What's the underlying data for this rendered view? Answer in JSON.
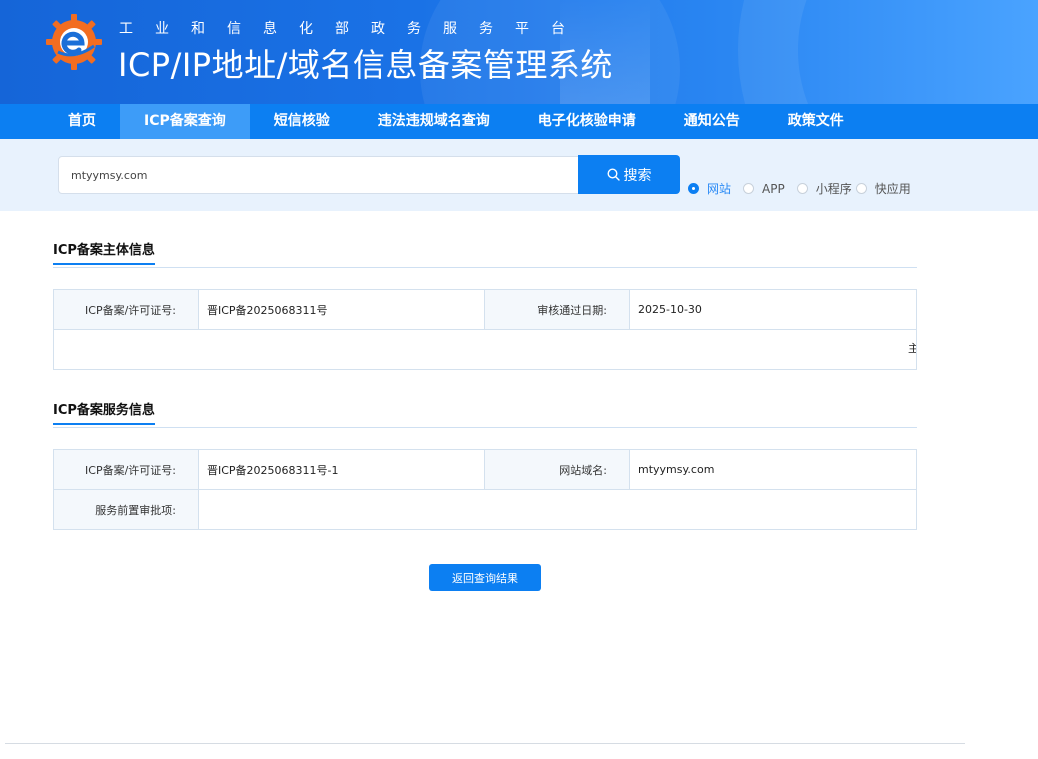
{
  "header": {
    "subtitle": "工业和信息化部政务服务平台",
    "title": "ICP/IP地址/域名信息备案管理系统",
    "logo_icon": "miit-gear-logo-icon",
    "colors": {
      "banner": "#1a72e6",
      "nav": "#0c7ff2",
      "nav_active": "#3d9cf8"
    }
  },
  "nav": {
    "items": [
      {
        "label": "首页"
      },
      {
        "label": "ICP备案查询"
      },
      {
        "label": "短信核验"
      },
      {
        "label": "违法违规域名查询"
      },
      {
        "label": "电子化核验申请"
      },
      {
        "label": "通知公告"
      },
      {
        "label": "政策文件"
      }
    ],
    "active": "ICP备案查询"
  },
  "search": {
    "value": "mtyymsy.com",
    "button_label": "搜索",
    "options": [
      {
        "label": "网站",
        "checked": true
      },
      {
        "label": "APP",
        "checked": false
      },
      {
        "label": "小程序",
        "checked": false
      },
      {
        "label": "快应用",
        "checked": false
      }
    ]
  },
  "subject": {
    "title": "ICP备案主体信息",
    "license_label": "ICP备案/许可证号:",
    "license_value": "晋ICP备2025068311号",
    "date_label": "审核通过日期:",
    "date_value": "2025-10-30",
    "overflow_text": "主"
  },
  "service": {
    "title": "ICP备案服务信息",
    "license_label": "ICP备案/许可证号:",
    "license_value": "晋ICP备2025068311号-1",
    "domain_label": "网站域名:",
    "domain_value": "mtyymsy.com",
    "preapproval_label": "服务前置审批项:",
    "preapproval_value": ""
  },
  "actions": {
    "back_label": "返回查询结果"
  }
}
